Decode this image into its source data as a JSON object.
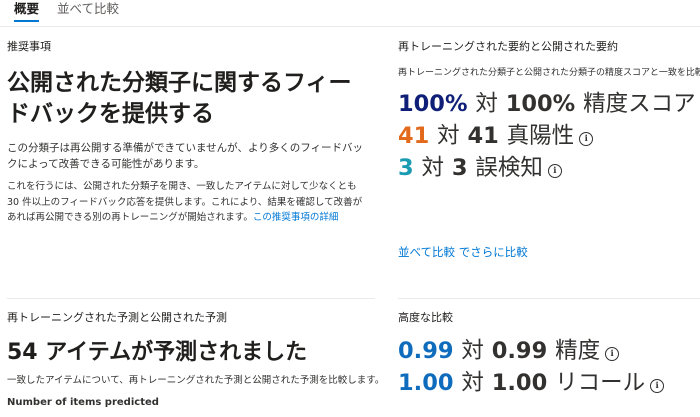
{
  "tabs": [
    {
      "label": "概要"
    },
    {
      "label": "並べて比較"
    }
  ],
  "recommendation": {
    "title": "推奨事項",
    "headline": "公開された分類子に関するフィードバックを提供する",
    "para1": "この分類子は再公開する準備ができていませんが、より多くのフィードバックによって改善できる可能性があります。",
    "para2": "これを行うには、公開された分類子を開き、一致したアイテムに対して少なくとも 30 件以上のフィードバック応答を提供します。これにより、結果を確認して改善があれば再公開できる別の再トレーニングが開始されます。",
    "details_link": "この推奨事項の詳細"
  },
  "summary": {
    "title": "再トレーニングされた要約と公開された要約",
    "subtitle": "再トレーニングされた分類子と公開された分類子の精度スコアと一致を比較します",
    "metrics": [
      {
        "left": "100%",
        "vs": "対",
        "right": "100%",
        "label": "精度スコア",
        "color": "#0f1f77",
        "info": false
      },
      {
        "left": "41",
        "vs": "対",
        "right": "41",
        "label": "真陽性",
        "color": "#e3691d",
        "info": true
      },
      {
        "left": "3",
        "vs": "対",
        "right": "3",
        "label": "誤検知",
        "color": "#1a9bb2",
        "info": true
      }
    ],
    "compare_side_by_side": "並べて比較",
    "compare_more": "でさらに比較"
  },
  "predictions": {
    "title": "再トレーニングされた予測と公開された予測",
    "headline": "54 アイテムが予測されました",
    "desc": "一致したアイテムについて、再トレーニングされた予測と公開された予測を比較します。",
    "cut_text": "Number of items predicted"
  },
  "advanced": {
    "title": "高度な比較",
    "metrics": [
      {
        "left": "0.99",
        "vs": "対",
        "right": "0.99",
        "label": "精度",
        "color": "#0f6cbd",
        "info": true
      },
      {
        "left": "1.00",
        "vs": "対",
        "right": "1.00",
        "label": "リコール",
        "color": "#0f6cbd",
        "info": true
      }
    ]
  },
  "colors": {
    "accent": "#0078d4",
    "precision": "#0f1f77",
    "true_positive": "#e3691d",
    "false_positive": "#1a9bb2",
    "advanced": "#0f6cbd"
  },
  "icons": {
    "info": "info-circle-icon"
  }
}
